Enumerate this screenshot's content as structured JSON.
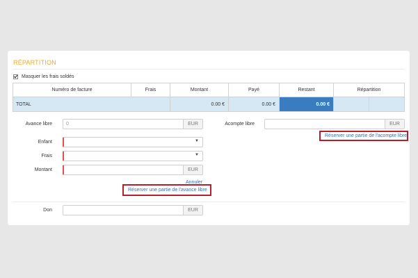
{
  "section": {
    "title": "RÉPARTITION"
  },
  "hide_paid": {
    "label": "Masquer les frais soldés",
    "checked": true
  },
  "table": {
    "headers": [
      "Numéro de facture",
      "Frais",
      "Montant",
      "Payé",
      "Restant",
      "Répartition"
    ],
    "total": {
      "label": "TOTAL",
      "frais": "",
      "montant": "0.00 €",
      "paye": "0.00 €",
      "restant": "0.00 €",
      "repartition": ""
    }
  },
  "avance_libre": {
    "label": "Avance libre",
    "value": "0",
    "unit": "EUR"
  },
  "acompte_libre": {
    "label": "Acompte libre",
    "value": "",
    "unit": "EUR",
    "reserve_link": "Réserver une partie de l'acompte libre"
  },
  "enfant": {
    "label": "Enfant",
    "value": ""
  },
  "frais": {
    "label": "Frais",
    "value": ""
  },
  "montant": {
    "label": "Montant",
    "value": "",
    "unit": "EUR"
  },
  "annuler": "Annuler",
  "reserve_avance_link": "Réserver une partie de l'avance libre",
  "don": {
    "label": "Don",
    "value": "",
    "unit": "EUR"
  },
  "colors": {
    "accent": "#f0a92b",
    "highlight": "#3a7cc0",
    "total_row": "#d6e8f4",
    "link": "#3a6fb0",
    "callout": "#b51f2b"
  }
}
